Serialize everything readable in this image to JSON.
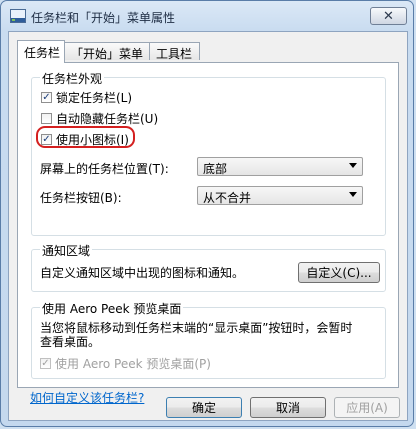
{
  "window": {
    "title": "任务栏和「开始」菜单属性",
    "close_label": "✕"
  },
  "tabs": [
    {
      "label": "任务栏",
      "active": true
    },
    {
      "label": "「开始」菜单",
      "active": false
    },
    {
      "label": "工具栏",
      "active": false
    }
  ],
  "appearance": {
    "group_label": "任务栏外观",
    "lock": {
      "label": "锁定任务栏(L)",
      "checked": true
    },
    "autohide": {
      "label": "自动隐藏任务栏(U)",
      "checked": false
    },
    "small_icons": {
      "label": "使用小图标(I)",
      "checked": true
    },
    "position": {
      "label": "屏幕上的任务栏位置(T):",
      "value": "底部"
    },
    "buttons": {
      "label": "任务栏按钮(B):",
      "value": "从不合并"
    }
  },
  "notify": {
    "group_label": "通知区域",
    "text": "自定义通知区域中出现的图标和通知。",
    "customize_label": "自定义(C)..."
  },
  "aero": {
    "group_label": "使用 Aero Peek 预览桌面",
    "line1": "当您将鼠标移动到任务栏末端的“显示桌面”按钮时，会暂时",
    "line2": "查看桌面。",
    "checkbox": {
      "label": "使用 Aero Peek 预览桌面(P)",
      "checked": true,
      "disabled": true
    }
  },
  "help_link": "如何自定义该任务栏?",
  "footer": {
    "ok_label": "确定",
    "cancel_label": "取消",
    "apply_label": "应用(A)"
  }
}
